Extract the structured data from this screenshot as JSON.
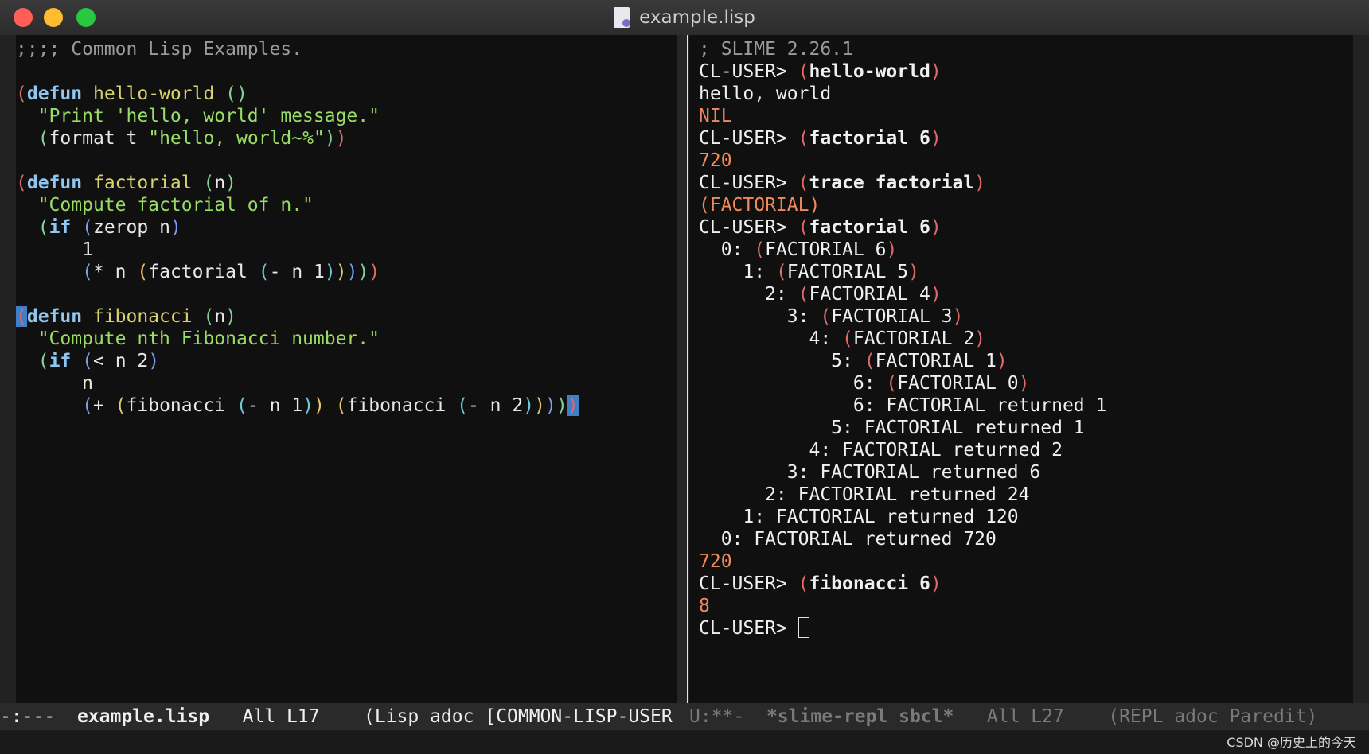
{
  "window": {
    "title": "example.lisp"
  },
  "left_code": [
    ";;;; Common Lisp Examples.",
    "",
    "(defun hello-world ()",
    "  \"Print 'hello, world' message.\"",
    "  (format t \"hello, world~%\"))",
    "",
    "(defun factorial (n)",
    "  \"Compute factorial of n.\"",
    "  (if (zerop n)",
    "      1",
    "      (* n (factorial (- n 1)))))",
    "",
    "(defun fibonacci (n)",
    "  \"Compute nth Fibonacci number.\"",
    "  (if (< n 2)",
    "      n",
    "      (+ (fibonacci (- n 1)) (fibonacci (- n 2)))))"
  ],
  "repl": {
    "banner": "; SLIME 2.26.1",
    "prompt": "CL-USER> ",
    "lines": [
      {
        "kind": "input",
        "text": "(hello-world)"
      },
      {
        "kind": "output",
        "text": "hello, world"
      },
      {
        "kind": "result",
        "text": "NIL"
      },
      {
        "kind": "input",
        "text": "(factorial 6)"
      },
      {
        "kind": "result",
        "text": "720"
      },
      {
        "kind": "input",
        "text": "(trace factorial)"
      },
      {
        "kind": "result",
        "text": "(FACTORIAL)"
      },
      {
        "kind": "input",
        "text": "(factorial 6)"
      },
      {
        "kind": "trace",
        "text": "  0: (FACTORIAL 6)"
      },
      {
        "kind": "trace",
        "text": "    1: (FACTORIAL 5)"
      },
      {
        "kind": "trace",
        "text": "      2: (FACTORIAL 4)"
      },
      {
        "kind": "trace",
        "text": "        3: (FACTORIAL 3)"
      },
      {
        "kind": "trace",
        "text": "          4: (FACTORIAL 2)"
      },
      {
        "kind": "trace",
        "text": "            5: (FACTORIAL 1)"
      },
      {
        "kind": "trace",
        "text": "              6: (FACTORIAL 0)"
      },
      {
        "kind": "trace",
        "text": "              6: FACTORIAL returned 1"
      },
      {
        "kind": "trace",
        "text": "            5: FACTORIAL returned 1"
      },
      {
        "kind": "trace",
        "text": "          4: FACTORIAL returned 2"
      },
      {
        "kind": "trace",
        "text": "        3: FACTORIAL returned 6"
      },
      {
        "kind": "trace",
        "text": "      2: FACTORIAL returned 24"
      },
      {
        "kind": "trace",
        "text": "    1: FACTORIAL returned 120"
      },
      {
        "kind": "trace",
        "text": "  0: FACTORIAL returned 720"
      },
      {
        "kind": "result",
        "text": "720"
      },
      {
        "kind": "input",
        "text": "(fibonacci 6)"
      },
      {
        "kind": "result",
        "text": "8"
      },
      {
        "kind": "prompt",
        "text": ""
      }
    ]
  },
  "modeline_left": {
    "status": "-:---",
    "buffer": "example.lisp",
    "position": "All L17",
    "modes": "(Lisp adoc [COMMON-LISP-USER"
  },
  "modeline_right": {
    "status": "U:**-",
    "buffer": "*slime-repl sbcl*",
    "position": "All L27",
    "modes": "(REPL adoc Paredit)"
  },
  "watermark": "CSDN @历史上的今天",
  "colors": {
    "keyword": "#8fc7f0",
    "function_name": "#d8d26f",
    "string": "#99dc66",
    "result": "#f08a5a",
    "paren_outer": "#e06a6a"
  }
}
